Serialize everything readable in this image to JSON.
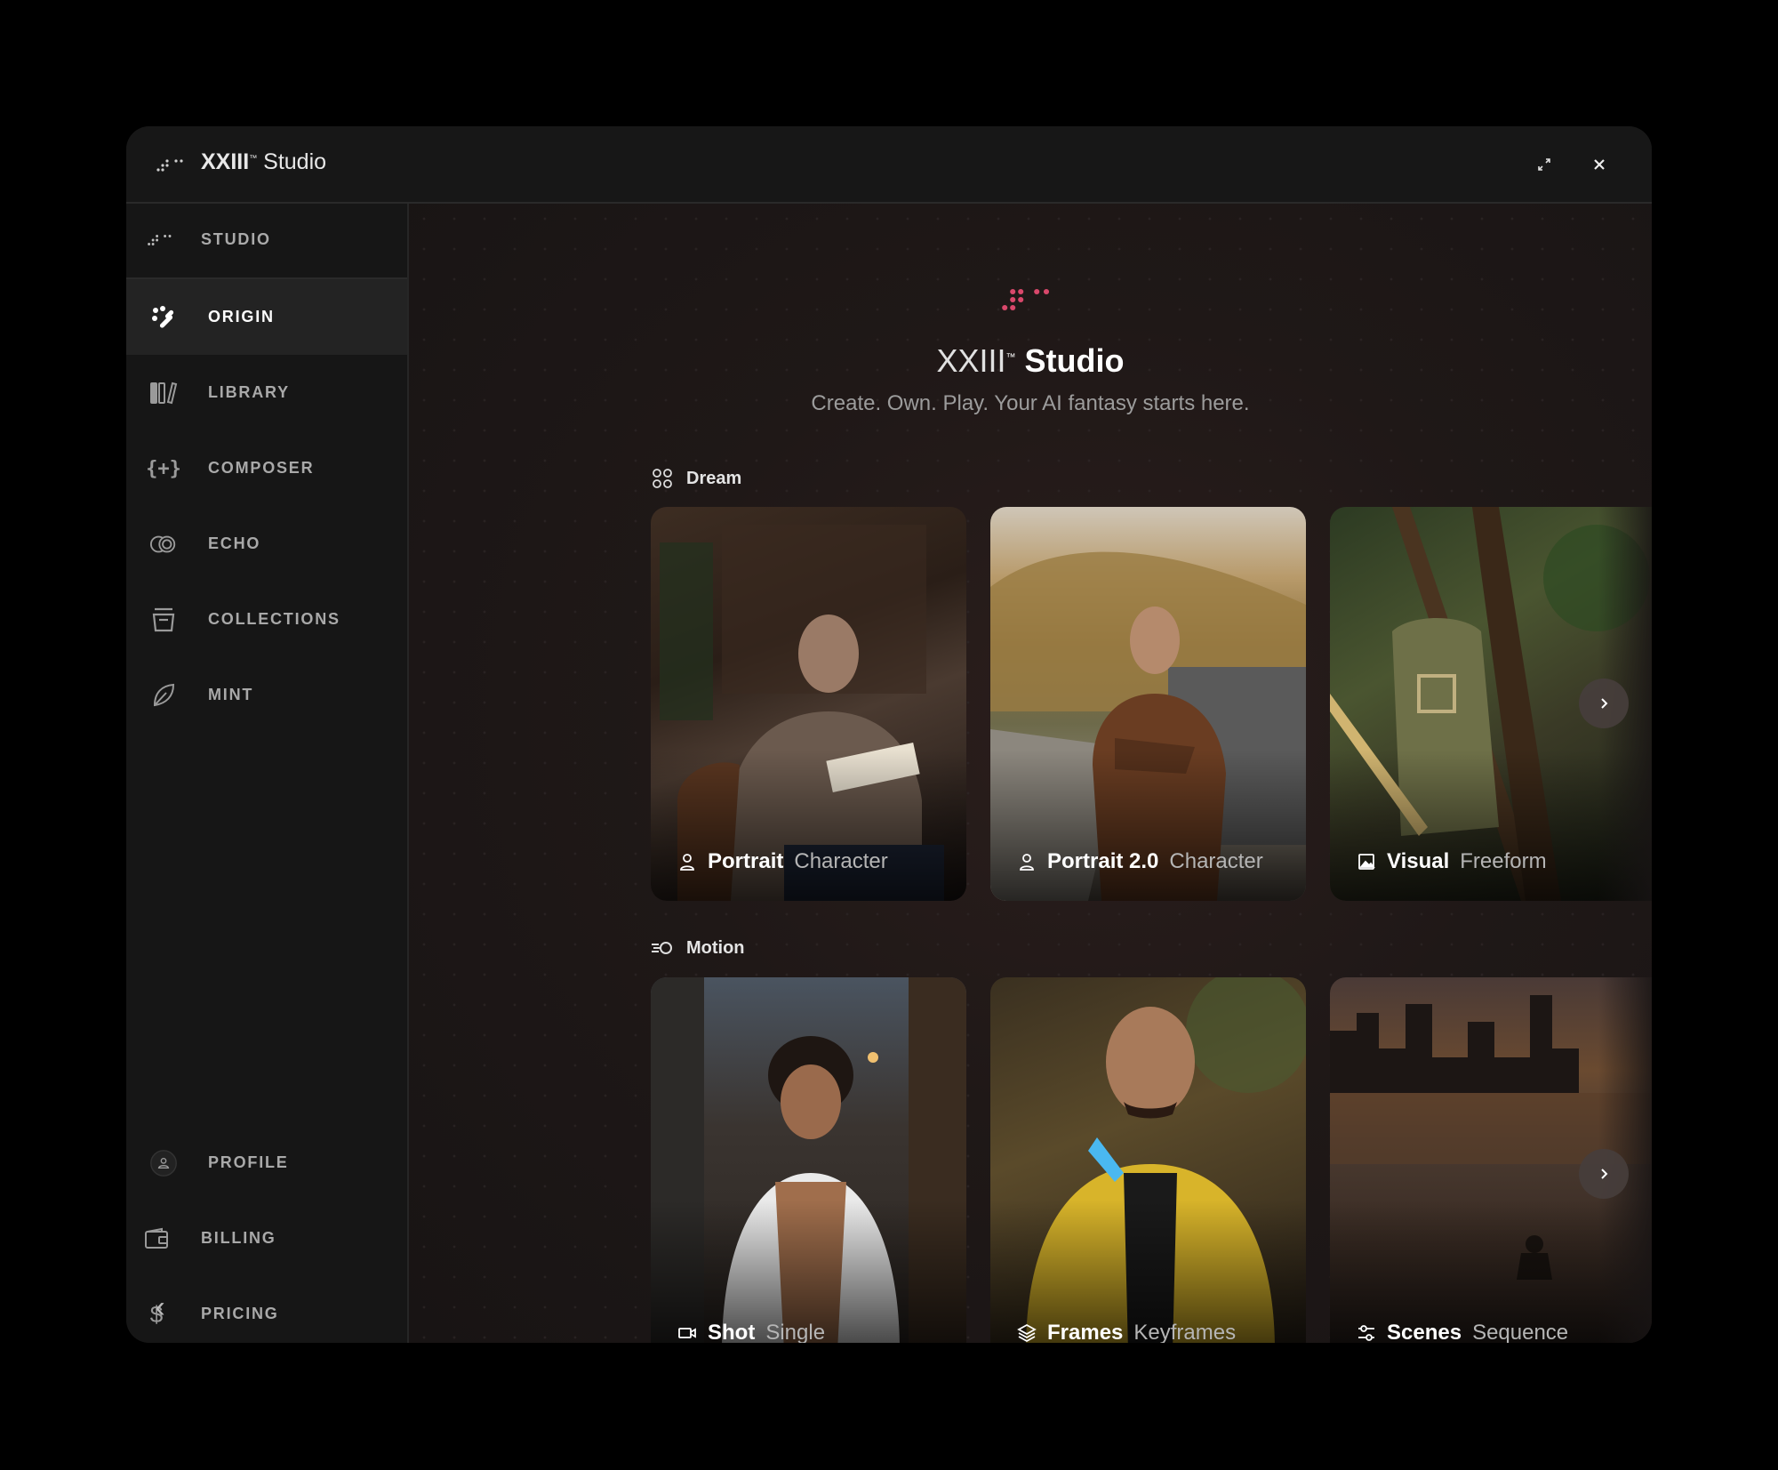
{
  "window": {
    "title_brand": "XXIII",
    "title_tm": "™",
    "title_rest": "Studio"
  },
  "sidebar": {
    "header_label": "STUDIO",
    "items": [
      {
        "label": "ORIGIN",
        "icon": "origin-icon",
        "active": true
      },
      {
        "label": "LIBRARY",
        "icon": "library-icon"
      },
      {
        "label": "COMPOSER",
        "icon": "composer-braces-icon"
      },
      {
        "label": "ECHO",
        "icon": "echo-icon"
      },
      {
        "label": "COLLECTIONS",
        "icon": "collections-icon"
      },
      {
        "label": "MINT",
        "icon": "leaf-icon"
      }
    ],
    "bottom_items": [
      {
        "label": "PROFILE",
        "icon": "user-icon"
      },
      {
        "label": "BILLING",
        "icon": "wallet-icon"
      },
      {
        "label": "PRICING",
        "icon": "dollar-icon",
        "glyph": "$"
      }
    ],
    "collapse_glyph": "‹"
  },
  "hero": {
    "title_brand": "XXIII",
    "title_tm": "™",
    "title_rest": "Studio",
    "subtitle": "Create. Own. Play. Your AI fantasy starts here.",
    "logo_color": "#d9486b"
  },
  "sections": [
    {
      "title": "Dream",
      "icon": "apps-grid-icon",
      "cards": [
        {
          "title": "Portrait",
          "subtitle": "Character",
          "icon": "user-icon"
        },
        {
          "title": "Portrait 2.0",
          "subtitle": "Character",
          "icon": "user-icon"
        },
        {
          "title": "Visual",
          "subtitle": "Freeform",
          "icon": "image-icon"
        }
      ]
    },
    {
      "title": "Motion",
      "icon": "motion-icon",
      "cards": [
        {
          "title": "Shot",
          "subtitle": "Single",
          "icon": "video-icon"
        },
        {
          "title": "Frames",
          "subtitle": "Keyframes",
          "icon": "layers-icon"
        },
        {
          "title": "Scenes",
          "subtitle": "Sequence",
          "icon": "sliders-icon"
        }
      ]
    }
  ]
}
